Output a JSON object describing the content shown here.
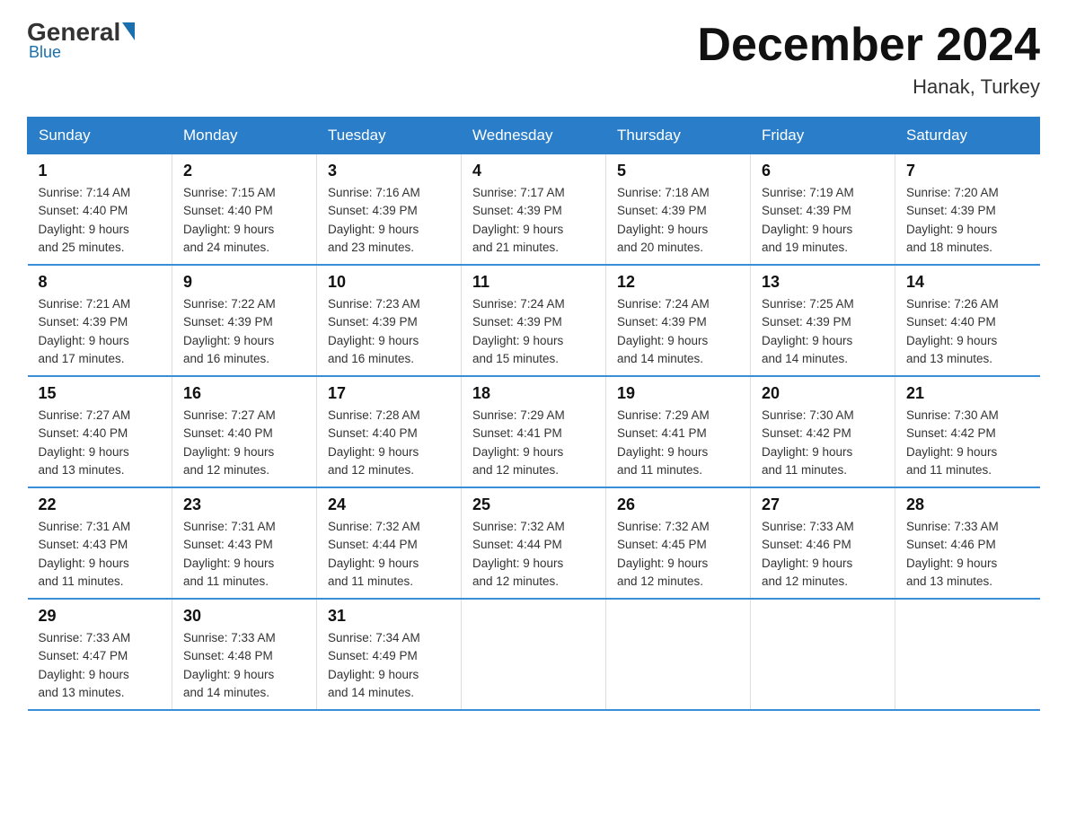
{
  "logo": {
    "general": "General",
    "blue": "Blue",
    "subtitle": "Blue"
  },
  "title": "December 2024",
  "location": "Hanak, Turkey",
  "days_of_week": [
    "Sunday",
    "Monday",
    "Tuesday",
    "Wednesday",
    "Thursday",
    "Friday",
    "Saturday"
  ],
  "weeks": [
    [
      {
        "day": "1",
        "sunrise": "7:14 AM",
        "sunset": "4:40 PM",
        "daylight": "9 hours and 25 minutes."
      },
      {
        "day": "2",
        "sunrise": "7:15 AM",
        "sunset": "4:40 PM",
        "daylight": "9 hours and 24 minutes."
      },
      {
        "day": "3",
        "sunrise": "7:16 AM",
        "sunset": "4:39 PM",
        "daylight": "9 hours and 23 minutes."
      },
      {
        "day": "4",
        "sunrise": "7:17 AM",
        "sunset": "4:39 PM",
        "daylight": "9 hours and 21 minutes."
      },
      {
        "day": "5",
        "sunrise": "7:18 AM",
        "sunset": "4:39 PM",
        "daylight": "9 hours and 20 minutes."
      },
      {
        "day": "6",
        "sunrise": "7:19 AM",
        "sunset": "4:39 PM",
        "daylight": "9 hours and 19 minutes."
      },
      {
        "day": "7",
        "sunrise": "7:20 AM",
        "sunset": "4:39 PM",
        "daylight": "9 hours and 18 minutes."
      }
    ],
    [
      {
        "day": "8",
        "sunrise": "7:21 AM",
        "sunset": "4:39 PM",
        "daylight": "9 hours and 17 minutes."
      },
      {
        "day": "9",
        "sunrise": "7:22 AM",
        "sunset": "4:39 PM",
        "daylight": "9 hours and 16 minutes."
      },
      {
        "day": "10",
        "sunrise": "7:23 AM",
        "sunset": "4:39 PM",
        "daylight": "9 hours and 16 minutes."
      },
      {
        "day": "11",
        "sunrise": "7:24 AM",
        "sunset": "4:39 PM",
        "daylight": "9 hours and 15 minutes."
      },
      {
        "day": "12",
        "sunrise": "7:24 AM",
        "sunset": "4:39 PM",
        "daylight": "9 hours and 14 minutes."
      },
      {
        "day": "13",
        "sunrise": "7:25 AM",
        "sunset": "4:39 PM",
        "daylight": "9 hours and 14 minutes."
      },
      {
        "day": "14",
        "sunrise": "7:26 AM",
        "sunset": "4:40 PM",
        "daylight": "9 hours and 13 minutes."
      }
    ],
    [
      {
        "day": "15",
        "sunrise": "7:27 AM",
        "sunset": "4:40 PM",
        "daylight": "9 hours and 13 minutes."
      },
      {
        "day": "16",
        "sunrise": "7:27 AM",
        "sunset": "4:40 PM",
        "daylight": "9 hours and 12 minutes."
      },
      {
        "day": "17",
        "sunrise": "7:28 AM",
        "sunset": "4:40 PM",
        "daylight": "9 hours and 12 minutes."
      },
      {
        "day": "18",
        "sunrise": "7:29 AM",
        "sunset": "4:41 PM",
        "daylight": "9 hours and 12 minutes."
      },
      {
        "day": "19",
        "sunrise": "7:29 AM",
        "sunset": "4:41 PM",
        "daylight": "9 hours and 11 minutes."
      },
      {
        "day": "20",
        "sunrise": "7:30 AM",
        "sunset": "4:42 PM",
        "daylight": "9 hours and 11 minutes."
      },
      {
        "day": "21",
        "sunrise": "7:30 AM",
        "sunset": "4:42 PM",
        "daylight": "9 hours and 11 minutes."
      }
    ],
    [
      {
        "day": "22",
        "sunrise": "7:31 AM",
        "sunset": "4:43 PM",
        "daylight": "9 hours and 11 minutes."
      },
      {
        "day": "23",
        "sunrise": "7:31 AM",
        "sunset": "4:43 PM",
        "daylight": "9 hours and 11 minutes."
      },
      {
        "day": "24",
        "sunrise": "7:32 AM",
        "sunset": "4:44 PM",
        "daylight": "9 hours and 11 minutes."
      },
      {
        "day": "25",
        "sunrise": "7:32 AM",
        "sunset": "4:44 PM",
        "daylight": "9 hours and 12 minutes."
      },
      {
        "day": "26",
        "sunrise": "7:32 AM",
        "sunset": "4:45 PM",
        "daylight": "9 hours and 12 minutes."
      },
      {
        "day": "27",
        "sunrise": "7:33 AM",
        "sunset": "4:46 PM",
        "daylight": "9 hours and 12 minutes."
      },
      {
        "day": "28",
        "sunrise": "7:33 AM",
        "sunset": "4:46 PM",
        "daylight": "9 hours and 13 minutes."
      }
    ],
    [
      {
        "day": "29",
        "sunrise": "7:33 AM",
        "sunset": "4:47 PM",
        "daylight": "9 hours and 13 minutes."
      },
      {
        "day": "30",
        "sunrise": "7:33 AM",
        "sunset": "4:48 PM",
        "daylight": "9 hours and 14 minutes."
      },
      {
        "day": "31",
        "sunrise": "7:34 AM",
        "sunset": "4:49 PM",
        "daylight": "9 hours and 14 minutes."
      },
      null,
      null,
      null,
      null
    ]
  ]
}
